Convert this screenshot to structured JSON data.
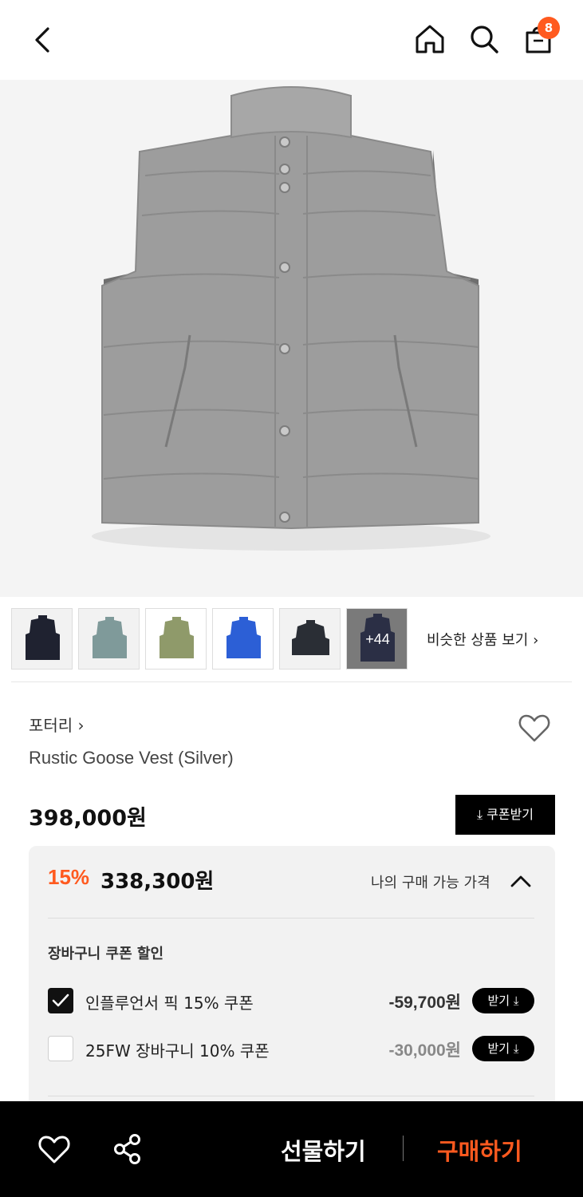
{
  "header": {
    "icons": [
      "back-arrow-icon",
      "home-icon",
      "search-icon",
      "shopping-bag-icon"
    ],
    "cart_count": "8"
  },
  "colors": {
    "accent": "#ff5a1f",
    "dark": "#000000",
    "panel_bg": "#f2f2f2",
    "vest_body": "#9c9c9c"
  },
  "thumbnails": {
    "more_label": "+44",
    "similar_label": "비슷한 상품 보기 ›",
    "colors": [
      "#1f2230",
      "#7f9a9a",
      "#8f9a6a",
      "#2c5fd6",
      "#2a2e35",
      "#2b2f45"
    ]
  },
  "product": {
    "brand": "포터리 ›",
    "name": "Rustic Goose Vest (Silver)",
    "price": "398,000원",
    "coupon_button": "⤓ 쿠폰받기"
  },
  "discount": {
    "percent": "15%",
    "sale_price": "338,300원",
    "my_price_label": "나의 구매 가능 가격",
    "section_title": "장바구니 쿠폰 할인",
    "coupons": [
      {
        "label": "인플루언서 픽 15% 쿠폰",
        "amount": "-59,700원",
        "button": "받기 ⤓",
        "checked": true
      },
      {
        "label": "25FW 장바구니 10% 쿠폰",
        "amount": "-30,000원",
        "button": "받기 ⤓",
        "checked": false
      }
    ]
  },
  "bottom_bar": {
    "gift": "선물하기",
    "buy": "구매하기"
  }
}
